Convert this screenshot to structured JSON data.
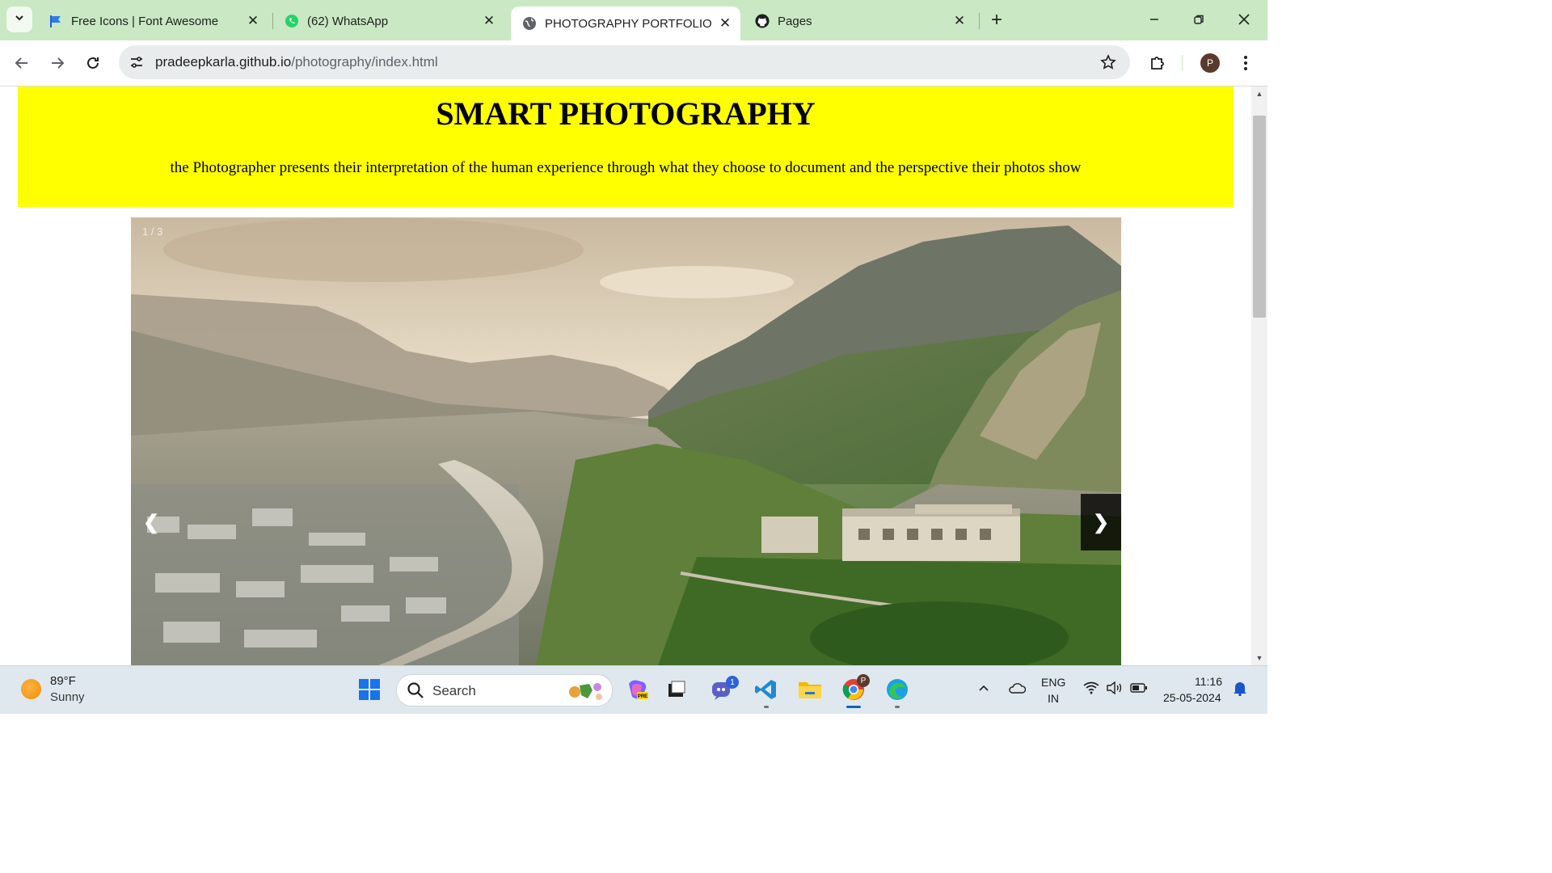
{
  "browser": {
    "tabs": [
      {
        "title": "Free Icons | Font Awesome",
        "icon": "font-awesome-flag-icon",
        "active": false
      },
      {
        "title": "(62) WhatsApp",
        "icon": "whatsapp-icon",
        "active": false
      },
      {
        "title": "PHOTOGRAPHY PORTFOLIO",
        "icon": "globe-icon",
        "active": true
      },
      {
        "title": "Pages",
        "icon": "github-icon",
        "active": false
      }
    ],
    "url_host": "pradeepkarla.github.io",
    "url_path": "/photography/index.html",
    "profile_initial": "P"
  },
  "page": {
    "heading": "SMART PHOTOGRAPHY",
    "tagline": "the Photographer presents their interpretation of the human experience through what they choose to document and the perspective their photos show",
    "slideshow": {
      "number_text": "1 / 3",
      "prev_label": "❮",
      "next_label": "❯",
      "image": "aerial view of city and river in mountain valley"
    }
  },
  "taskbar": {
    "weather_temp": "89°F",
    "weather_desc": "Sunny",
    "search_placeholder": "Search",
    "lang_line1": "ENG",
    "lang_line2": "IN",
    "time": "11:16",
    "date": "25-05-2024",
    "teams_badge": "1",
    "chrome_badge": "P"
  },
  "colors": {
    "tabstrip": "#c9e8c3",
    "hero_bg": "#ffff00",
    "taskbar": "#dfe8ee"
  }
}
